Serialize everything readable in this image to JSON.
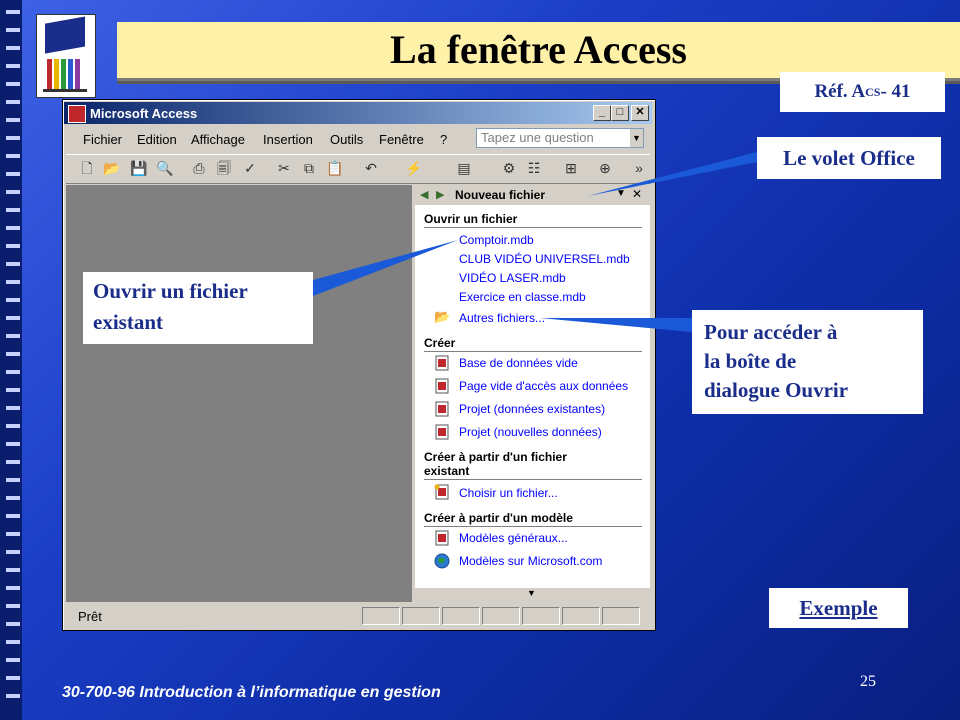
{
  "slide": {
    "title": "La fenêtre Access",
    "ref_text": "Réf. A",
    "ref_sub": "CS",
    "ref_num": " - 41",
    "footer": "30-700-96 Introduction à l’informatique en gestion",
    "page_number": "25",
    "example_link": "Exemple"
  },
  "callouts": {
    "office_pane": "Le volet Office",
    "open_existing_line1": "Ouvrir un fichier",
    "open_existing_line2": "existant",
    "open_dialog_line1": "Pour accéder à",
    "open_dialog_line2": "la boîte de",
    "open_dialog_line3": "dialogue Ouvrir"
  },
  "window": {
    "title": "Microsoft Access",
    "menus": [
      {
        "label": "Fichier"
      },
      {
        "label": "Edition"
      },
      {
        "label": "Affichage"
      },
      {
        "label": "Insertion"
      },
      {
        "label": "Outils"
      },
      {
        "label": "Fenêtre"
      },
      {
        "label": "?"
      }
    ],
    "question_placeholder": "Tapez une question",
    "status": "Prêt"
  },
  "task_pane": {
    "title": "Nouveau fichier",
    "open_section": "Ouvrir un fichier",
    "recent_files": [
      "Comptoir.mdb",
      "CLUB VIDÉO UNIVERSEL.mdb",
      "VIDÉO LASER.mdb",
      "Exercice en classe.mdb"
    ],
    "more_files": "Autres fichiers...",
    "create_section": "Créer",
    "create_items": [
      "Base de données vide",
      "Page vide d'accès aux données",
      "Projet (données existantes)",
      "Projet (nouvelles données)"
    ],
    "from_existing_section_1": "Créer à partir d'un fichier",
    "from_existing_section_2": "existant",
    "choose_file": "Choisir un fichier...",
    "from_template_section": "Créer à partir d'un modèle",
    "template_items": [
      "Modèles généraux...",
      "Modèles sur Microsoft.com"
    ]
  },
  "colors": {
    "background": "#1c3fc8",
    "banner": "#fff2a8",
    "callout_text": "#1a2d8a",
    "link": "#0000ff"
  }
}
